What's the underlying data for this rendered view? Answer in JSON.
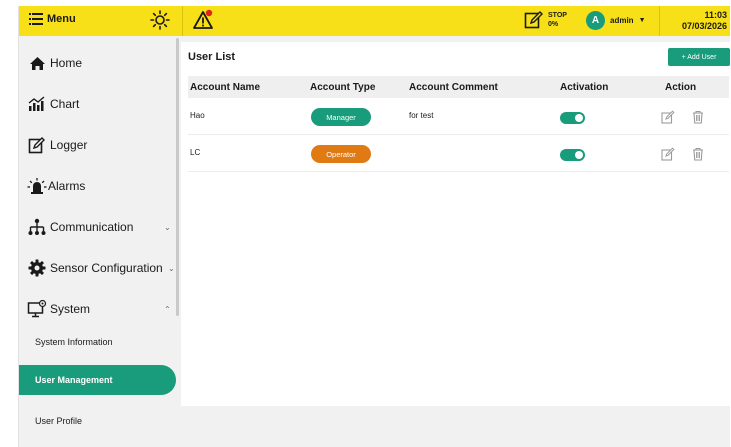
{
  "header": {
    "menu_label": "Menu",
    "status_line1": "STOP",
    "status_line2": "0%",
    "user_initial": "A",
    "user_name": "admin",
    "time": "11:03",
    "date": "07/03/2026"
  },
  "sidebar": {
    "items": [
      {
        "label": "Home",
        "icon": "home-icon"
      },
      {
        "label": "Chart",
        "icon": "chart-icon"
      },
      {
        "label": "Logger",
        "icon": "logger-icon"
      },
      {
        "label": "Alarms",
        "icon": "alarm-icon"
      },
      {
        "label": "Communication",
        "icon": "network-icon",
        "chevron": "⌄"
      },
      {
        "label": "Sensor Configuration",
        "icon": "gear-icon",
        "chevron": "⌄"
      },
      {
        "label": "System",
        "icon": "monitor-icon",
        "chevron": "⌃"
      }
    ],
    "subitems": [
      {
        "label": "System Information"
      },
      {
        "label": "User Management",
        "active": true
      },
      {
        "label": "User Profile"
      }
    ]
  },
  "main": {
    "title": "User List",
    "add_button": "+ Add User",
    "columns": [
      "Account Name",
      "Account Type",
      "Account Comment",
      "Activation",
      "Action"
    ],
    "rows": [
      {
        "name": "Hao",
        "type": "Manager",
        "type_color": "#189c7b",
        "comment": "for test",
        "active": true
      },
      {
        "name": "LC",
        "type": "Operator",
        "type_color": "#e07b14",
        "comment": "",
        "active": true
      }
    ]
  },
  "colors": {
    "topbar": "#f7e017",
    "accent": "#189c7b",
    "operator": "#e07b14",
    "warning": "#e0241b"
  }
}
